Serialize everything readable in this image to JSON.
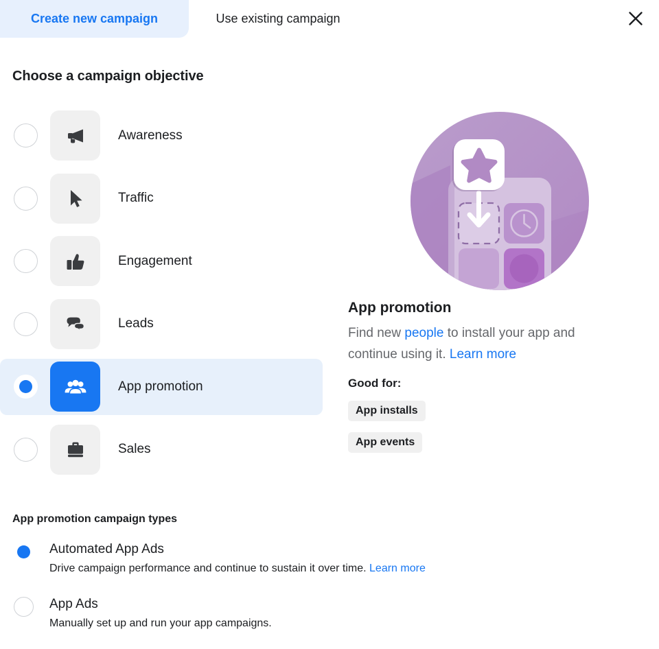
{
  "tabs": [
    {
      "id": "create-new-campaign",
      "label": "Create new campaign",
      "active": true
    },
    {
      "id": "use-existing-campaign",
      "label": "Use existing campaign",
      "active": false
    }
  ],
  "close_icon": "close-icon",
  "objective_section": {
    "title": "Choose a campaign objective",
    "options": [
      {
        "label": "Awareness",
        "icon": "megaphone-icon",
        "selected": false
      },
      {
        "label": "Traffic",
        "icon": "cursor-icon",
        "selected": false
      },
      {
        "label": "Engagement",
        "icon": "thumbs-up-icon",
        "selected": false
      },
      {
        "label": "Leads",
        "icon": "speech-bubbles-icon",
        "selected": false
      },
      {
        "label": "App promotion",
        "icon": "people-group-icon",
        "selected": true
      },
      {
        "label": "Sales",
        "icon": "briefcase-icon",
        "selected": false
      }
    ]
  },
  "detail": {
    "illustration": "app-install-illustration",
    "title": "App promotion",
    "desc_part_1": "Find new ",
    "desc_link_people": "people",
    "desc_part_2": " to install your app and continue using it. ",
    "desc_link_learn_more": "Learn more",
    "good_for_label": "Good for:",
    "chips": [
      "App installs",
      "App events"
    ]
  },
  "campaign_types": {
    "title": "App promotion campaign types",
    "options": [
      {
        "label": "Automated App Ads",
        "desc": "Drive campaign performance and continue to sustain it over time. ",
        "link": "Learn more",
        "selected": true
      },
      {
        "label": "App Ads",
        "desc": "Manually set up and run your app campaigns.",
        "link": "",
        "selected": false
      }
    ]
  },
  "colors": {
    "accent_blue": "#1877f2",
    "tab_active_bg": "#e7f0fd",
    "row_selected_bg": "#e7f0fb",
    "tile_bg": "#f0f0f0",
    "muted_text": "#65676b",
    "illustration_purple": "#b593c6"
  }
}
